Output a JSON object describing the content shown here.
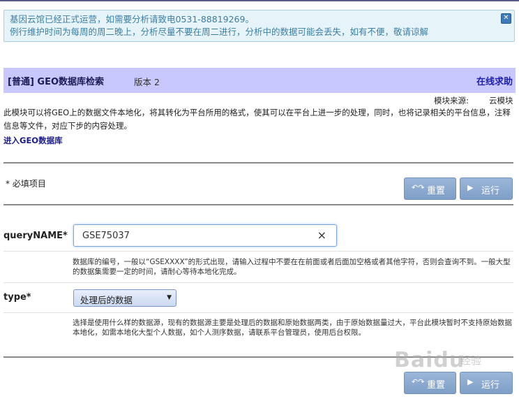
{
  "notice": {
    "line1": "基因云馆已经正式运营，如需要分析请致电0531-88819269。",
    "line2": "例行维护时间为每周的周二晚上，分析尽量不要在周二进行，分析中的数据可能会丢失，如有不便，敬请谅解",
    "close_glyph": "✕"
  },
  "header": {
    "title": "[普通] GEO数据库检索",
    "version": "版本 2",
    "help_link": "在线求助"
  },
  "module_source": {
    "label": "模块来源:",
    "value": "云模块"
  },
  "description": "此模块可以将GEO上的数据文件本地化，将其转化为平台所用的格式，使其可以在平台上进一步的处理，同时，也将记录相关的平台信息，注释信息等文件，对应下步的内容处理。",
  "geo_link": "进入GEO数据库",
  "form": {
    "required_note": "* 必填项目",
    "reset_label": "重置",
    "run_label": "运行",
    "reset_icon": "reset-arrows-icon",
    "run_icon": "play-icon",
    "fields": {
      "query": {
        "label": "queryNAME*",
        "value": "GSE75037",
        "help": "数据库的编号，一般以“GSEXXXX”的形式出现，请输入过程中不要在在前面或者后面加空格或者其他字符，否则会查询不到。一般大型的数据集需要一定的时间，请耐心等待本地化完成。"
      },
      "type": {
        "label": "type*",
        "selected": "处理后的数据",
        "help": "选择是使用什么样的数据源，现有的数据源主要是处理后的数据和原始数据两类，由于原始数据量过大，平台此模块暂时不支持原始数据本地化，如需本地化大型个人数据，如个人测序数据，请联系平台管理员，使用后台权限。"
      }
    }
  },
  "watermark": {
    "main": "Baidu",
    "sub": "经验"
  },
  "colors": {
    "title_bar_bg": "#c8c8ff",
    "notice_bg": "#e6f3f8",
    "notice_text": "#3d7fa3",
    "button_bg": "#8eabd1",
    "link": "#1c1c8a"
  }
}
